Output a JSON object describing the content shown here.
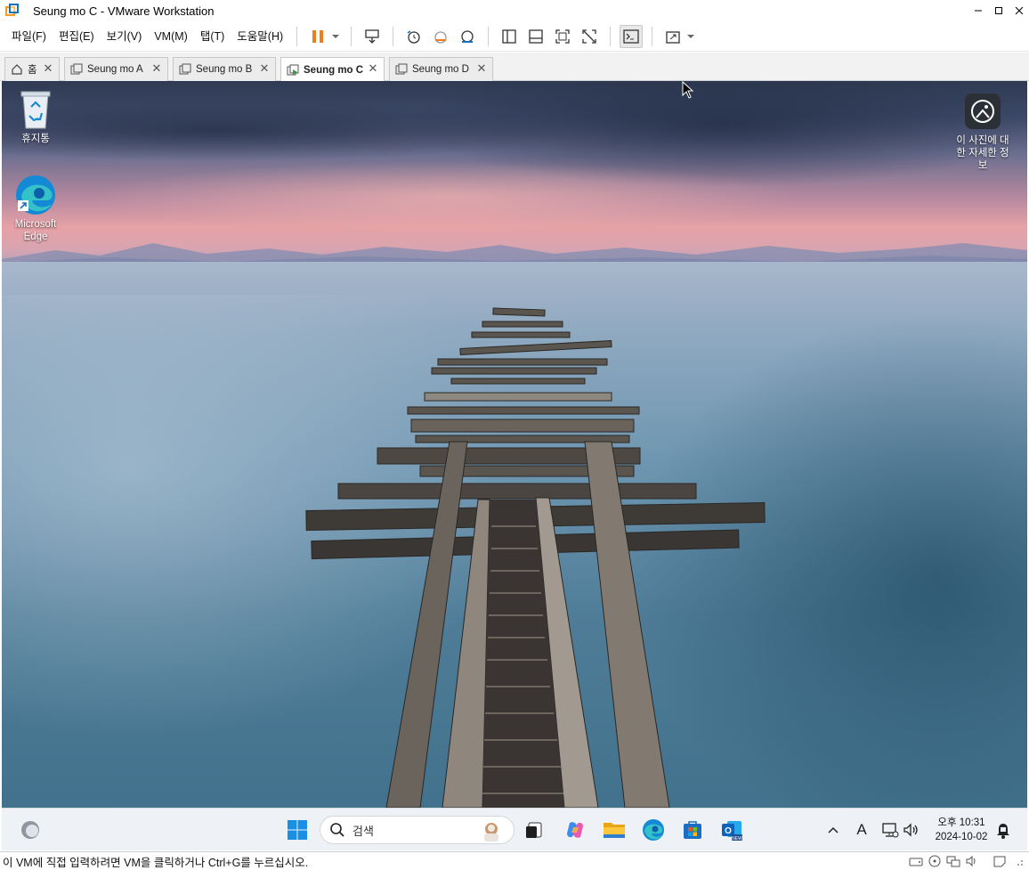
{
  "window": {
    "title": "Seung mo C - VMware Workstation",
    "minimize": "–",
    "maximize": "□",
    "close": "✕"
  },
  "menu": {
    "items": [
      "파일(F)",
      "편집(E)",
      "보기(V)",
      "VM(M)",
      "탭(T)",
      "도움말(H)"
    ]
  },
  "toolbar": {
    "icons": [
      "pause-icon",
      "send-keys-icon",
      "snapshot-icon",
      "revert-snapshot-icon",
      "snapshot-manager-icon",
      "library-icon",
      "thumbnail-bar-icon",
      "full-screen-icon",
      "unity-icon",
      "console-view-icon",
      "stretch-icon"
    ]
  },
  "tabs": [
    {
      "label": "홈",
      "active": false
    },
    {
      "label": "Seung mo A",
      "active": false
    },
    {
      "label": "Seung mo B",
      "active": false
    },
    {
      "label": "Seung mo C",
      "active": true
    },
    {
      "label": "Seung mo D",
      "active": false
    }
  ],
  "desktop": {
    "icons": [
      {
        "label": "휴지통",
        "icon": "recycle-bin-icon"
      },
      {
        "label": "Microsoft Edge",
        "icon": "edge-icon"
      },
      {
        "label": "이 사진에 대한 자세한 정보",
        "icon": "spotlight-info-icon"
      }
    ]
  },
  "taskbar": {
    "search_placeholder": "검색",
    "apps": [
      "widgets-icon",
      "start-icon",
      "task-view-icon",
      "copilot-icon",
      "file-explorer-icon",
      "edge-icon",
      "store-icon",
      "outlook-icon"
    ],
    "tray": {
      "chevron": "^",
      "ime": "A",
      "time": "오후 10:31",
      "date": "2024-10-02"
    }
  },
  "status": {
    "text": "이 VM에 직접 입력하려면 VM을 클릭하거나 Ctrl+G를 누르십시오."
  },
  "colors": {
    "accent": "#1a73b8",
    "pause_orange": "#f07d1a",
    "taskbar_bg": "#eef1f5"
  }
}
